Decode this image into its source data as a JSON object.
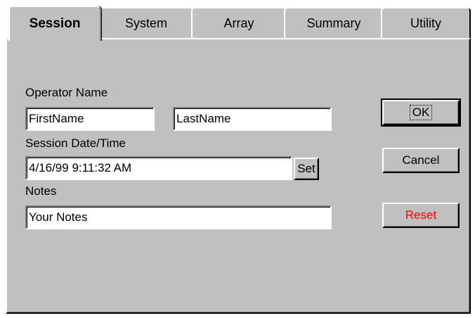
{
  "tabs": [
    {
      "label": "Session",
      "active": true
    },
    {
      "label": "System",
      "active": false
    },
    {
      "label": "Array",
      "active": false
    },
    {
      "label": "Summary",
      "active": false
    },
    {
      "label": "Utility",
      "active": false
    }
  ],
  "session": {
    "operator_label": "Operator Name",
    "first_name": "FirstName",
    "last_name": "LastName",
    "datetime_label": "Session Date/Time",
    "datetime_value": "4/16/99 9:11:32 AM",
    "set_button": "Set",
    "notes_label": "Notes",
    "notes_value": "Your Notes"
  },
  "buttons": {
    "ok": "OK",
    "cancel": "Cancel",
    "reset": "Reset"
  },
  "colors": {
    "face": "#c0c0c0",
    "reset_text": "#ff0000"
  }
}
